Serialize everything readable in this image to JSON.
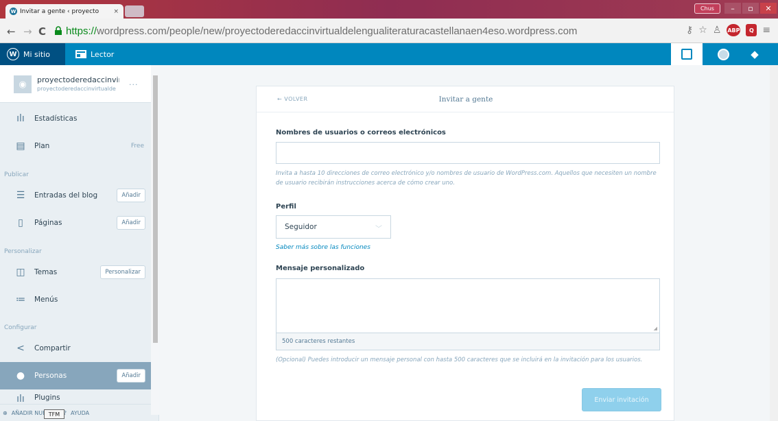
{
  "browser": {
    "tab_title": "Invitar a gente ‹ proyecto",
    "tab_close": "×",
    "user_label": "Chus",
    "url_scheme": "https://",
    "url_rest": "wordpress.com/people/new/proyectoderedaccinvirtualdelengualiteraturacastellanaen4eso.wordpress.com",
    "win_minimize": "–",
    "win_maximize": "▫",
    "win_close": "✕"
  },
  "masterbar": {
    "my_site": "Mi sitio",
    "reader": "Lector"
  },
  "sidebar": {
    "site_name": "proyectoderedaccinvirtu",
    "site_url": "proyectoderedaccinvirtualde",
    "site_more": "...",
    "items": [
      {
        "label": "Estadísticas",
        "icon": "▐▌"
      },
      {
        "label": "Plan",
        "extra": "Free"
      },
      {
        "label": "Entradas del blog",
        "button": "Añadir"
      },
      {
        "label": "Páginas",
        "button": "Añadir"
      },
      {
        "label": "Temas",
        "button": "Personalizar"
      },
      {
        "label": "Menús"
      },
      {
        "label": "Compartir"
      },
      {
        "label": "Personas",
        "button": "Añadir"
      },
      {
        "label": "Plugins"
      }
    ],
    "sections": {
      "publish": "Publicar",
      "customize": "Personalizar",
      "configure": "Configurar"
    },
    "footer": {
      "add_new": "AÑADIR NUEVO",
      "help": "AYUDA",
      "tooltip": "TFM"
    }
  },
  "card": {
    "back": "VOLVER",
    "title": "Invitar a gente",
    "usernames_label": "Nombres de usuarios o correos electrónicos",
    "usernames_help": "Invita a hasta 10 direcciones de correo electrónico y/o nombres de usuario de WordPress.com. Aquellos que necesiten un nombre de usuario recibirán instrucciones acerca de cómo crear uno.",
    "role_label": "Perfil",
    "role_value": "Seguidor",
    "role_link": "Saber más sobre las funciones",
    "message_label": "Mensaje personalizado",
    "counter": "500 caracteres restantes",
    "message_help": "(Opcional) Puedes introducir un mensaje personal con hasta 500 caracteres que se incluirá en la invitación para los usuarios.",
    "submit": "Enviar invitación"
  },
  "colors": {
    "masterbar": "#0087be",
    "masterbar_active": "#005082",
    "sidebar_bg": "#e9eff3",
    "active_item": "#87a6bc",
    "submit_disabled": "#8fd0ec"
  }
}
